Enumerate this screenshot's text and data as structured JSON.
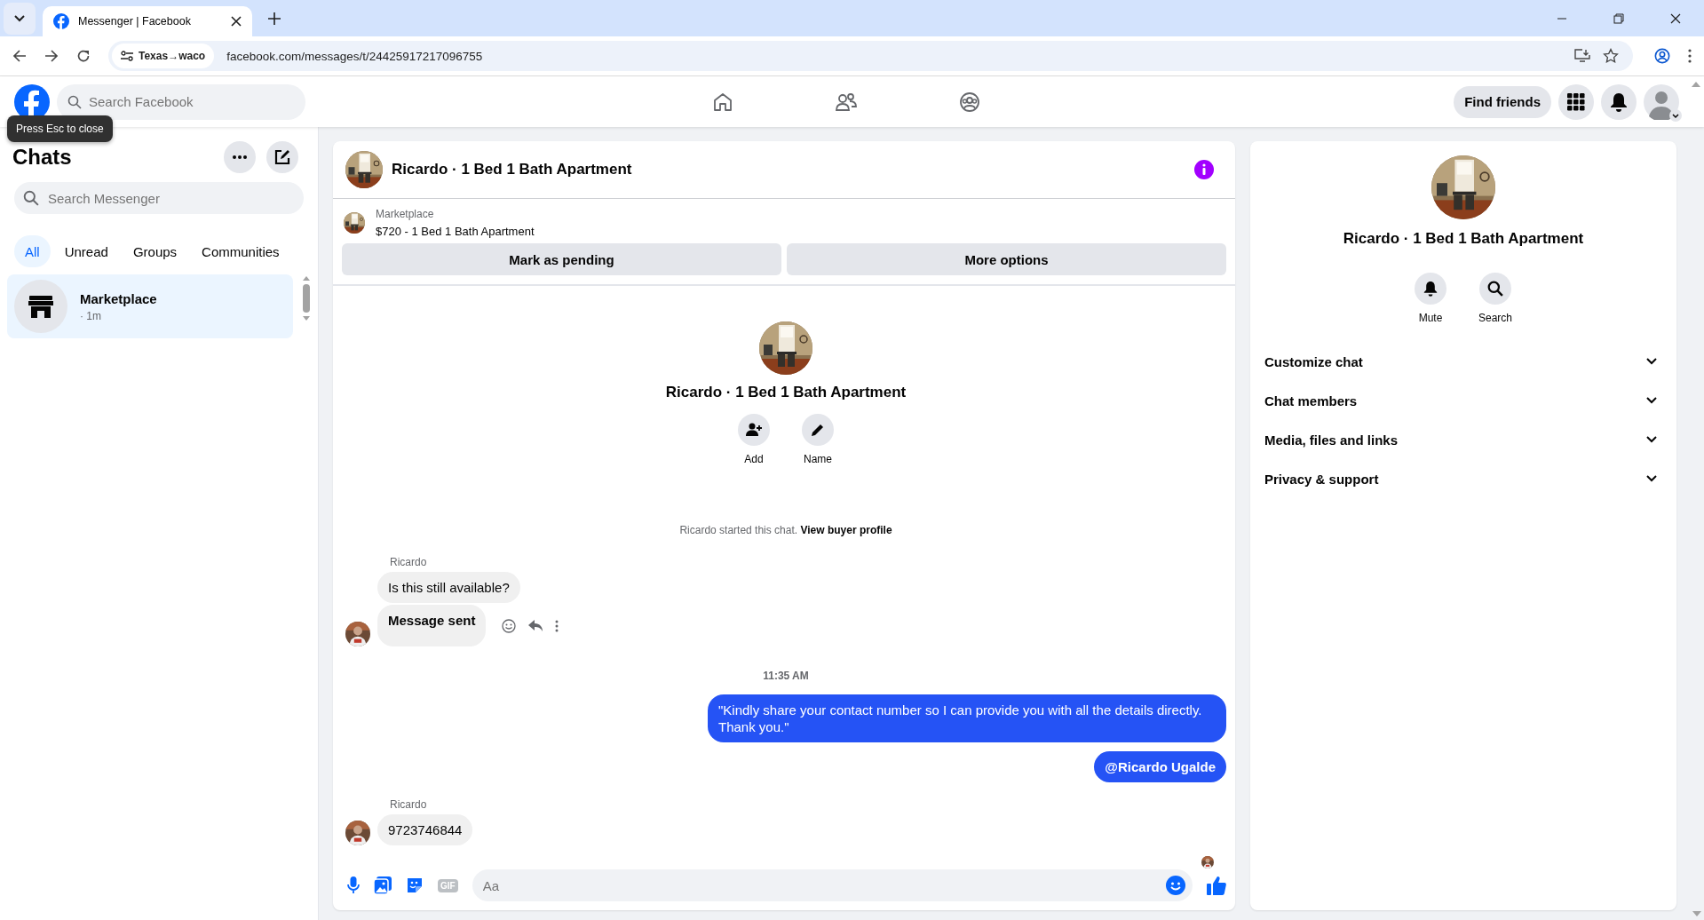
{
  "browser": {
    "tab_title": "Messenger | Facebook",
    "site_chip": "Texas→waco",
    "url": "facebook.com/messages/t/24425917217096755"
  },
  "header": {
    "search_placeholder": "Search Facebook",
    "find_friends": "Find friends"
  },
  "tooltip": "Press Esc to close",
  "sidebar": {
    "title": "Chats",
    "search_placeholder": "Search Messenger",
    "filters": [
      {
        "label": "All",
        "selected": true
      },
      {
        "label": "Unread",
        "selected": false
      },
      {
        "label": "Groups",
        "selected": false
      },
      {
        "label": "Communities",
        "selected": false
      }
    ],
    "chats": [
      {
        "name": "Marketplace",
        "time": "· 1m",
        "selected": true
      }
    ]
  },
  "conversation": {
    "title": "Ricardo · 1 Bed 1 Bath Apartment",
    "listing": {
      "source": "Marketplace",
      "title": "$720 - 1 Bed 1 Bath Apartment"
    },
    "actions": [
      "Mark as pending",
      "More options"
    ],
    "intro": {
      "name": "Ricardo · 1 Bed 1 Bath Apartment",
      "buttons": [
        {
          "kind": "add",
          "label": "Add"
        },
        {
          "kind": "name",
          "label": "Name"
        }
      ],
      "note": "Ricardo started this chat.",
      "note_link": "View buyer profile"
    },
    "messages": [
      {
        "kind": "sender",
        "text": "Ricardo"
      },
      {
        "kind": "incoming",
        "text": "Is this still available?",
        "avatar": false,
        "show_actions": false
      },
      {
        "kind": "notice",
        "text": "Message sent",
        "avatar": true,
        "show_actions": true
      },
      {
        "kind": "time",
        "text": "11:35 AM"
      },
      {
        "kind": "outgoing",
        "text": "\"Kindly share your contact number so I can provide you with all the details directly. Thank you.\""
      },
      {
        "kind": "mention",
        "text": "@Ricardo Ugalde"
      },
      {
        "kind": "sender",
        "text": "Ricardo"
      },
      {
        "kind": "incoming",
        "text": "9723746844",
        "avatar": true,
        "show_actions": false
      },
      {
        "kind": "seen"
      }
    ],
    "composer": {
      "gif_label": "GIF",
      "placeholder": "Aa"
    }
  },
  "details": {
    "name": "Ricardo · 1 Bed 1 Bath Apartment",
    "buttons": [
      {
        "kind": "mute",
        "label": "Mute"
      },
      {
        "kind": "search",
        "label": "Search"
      }
    ],
    "sections": [
      {
        "label": "Customize chat",
        "expanded": false
      },
      {
        "label": "Chat members",
        "expanded": false
      },
      {
        "label": "Media, files and links",
        "expanded": false
      },
      {
        "label": "Privacy & support",
        "expanded": false
      }
    ]
  }
}
